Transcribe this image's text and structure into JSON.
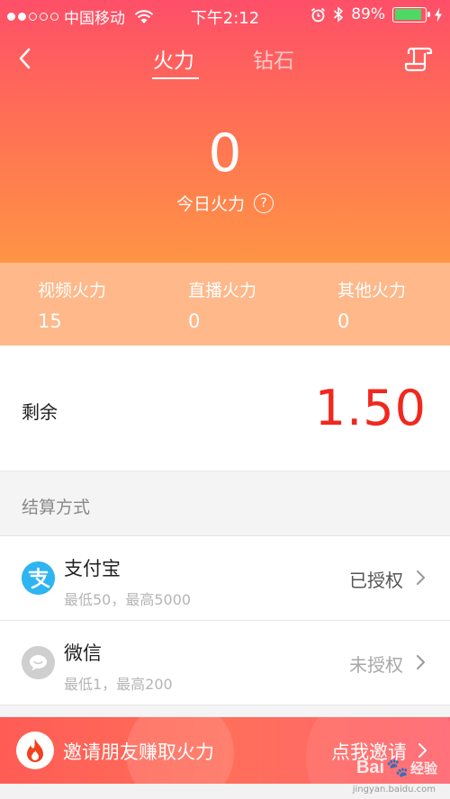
{
  "status_bar": {
    "carrier": "中国移动",
    "time": "下午2:12",
    "battery": "89%",
    "battery_level": 0.89
  },
  "nav": {
    "tabs": [
      {
        "label": "火力",
        "active": true
      },
      {
        "label": "钻石",
        "active": false
      }
    ]
  },
  "today": {
    "value": "0",
    "label": "今日火力"
  },
  "stats": [
    {
      "label": "视频火力",
      "value": "15"
    },
    {
      "label": "直播火力",
      "value": "0"
    },
    {
      "label": "其他火力",
      "value": "0"
    }
  ],
  "remaining": {
    "label": "剩余",
    "value": "1.50"
  },
  "settlement": {
    "title": "结算方式",
    "methods": [
      {
        "name": "支付宝",
        "limit": "最低50，最高5000",
        "status": "已授权"
      },
      {
        "name": "微信",
        "limit": "最低1，最高200",
        "status": "未授权"
      }
    ]
  },
  "invite": {
    "text": "邀请朋友赚取火力",
    "action": "点我邀请"
  },
  "watermark": {
    "brand": "Bai",
    "brand2": "经验",
    "url": "jingyan.baidu.com"
  },
  "colors": {
    "accent_red": "#f0281e",
    "alipay_blue": "#2fb4f2",
    "header_top": "#fe4f68",
    "header_bottom": "#ff9446"
  }
}
